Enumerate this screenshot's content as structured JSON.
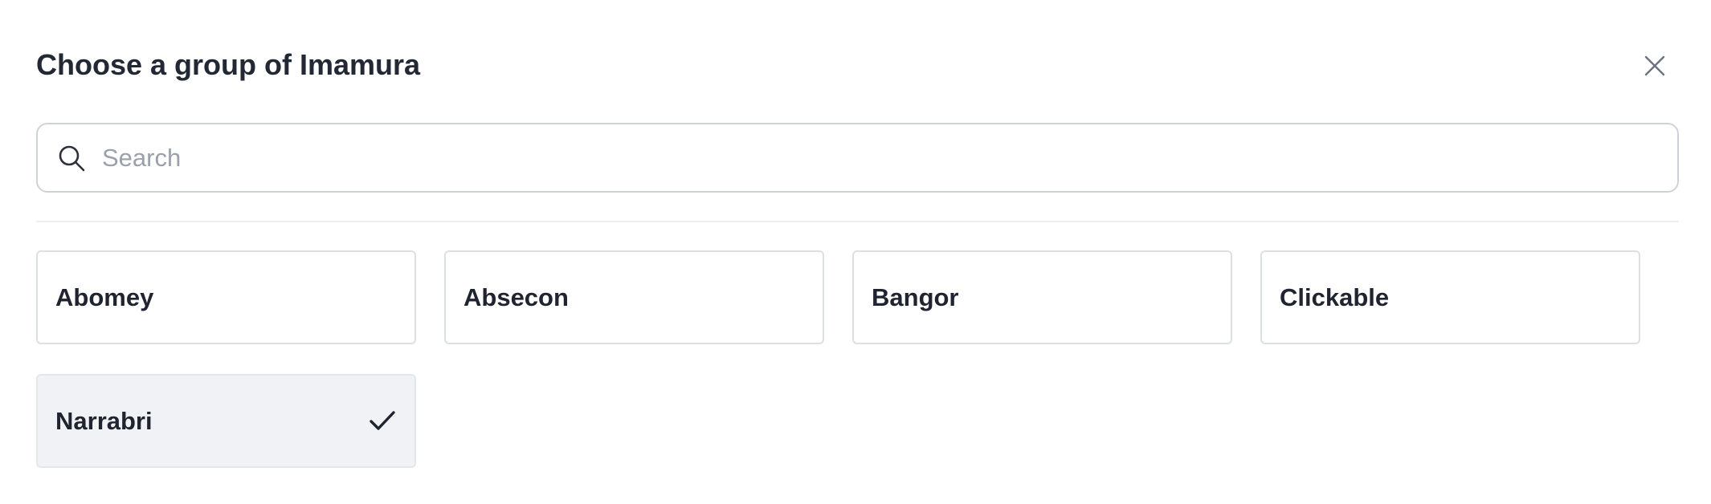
{
  "dialog": {
    "title": "Choose a group of Imamura",
    "close_icon": "close-icon"
  },
  "search": {
    "placeholder": "Search",
    "value": "",
    "icon": "search-icon"
  },
  "options": [
    {
      "label": "Abomey",
      "selected": false
    },
    {
      "label": "Absecon",
      "selected": false
    },
    {
      "label": "Bangor",
      "selected": false
    },
    {
      "label": "Clickable",
      "selected": false
    },
    {
      "label": "Narrabri",
      "selected": true,
      "icon": "checkmark-icon"
    }
  ],
  "colors": {
    "text": "#1f2430",
    "border": "#dcdfe4",
    "selected_bg": "#f1f2f5",
    "placeholder": "#9aa1ab"
  }
}
